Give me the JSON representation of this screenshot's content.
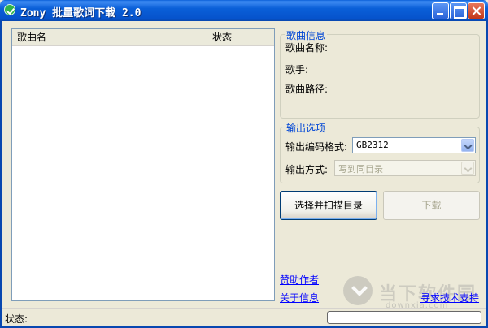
{
  "window": {
    "title": "Zony 批量歌词下载 2.0"
  },
  "list": {
    "columns": [
      "歌曲名",
      "状态"
    ]
  },
  "song_info": {
    "group_title": "歌曲信息",
    "name_label": "歌曲名称:",
    "artist_label": "歌手:",
    "path_label": "歌曲路径:"
  },
  "output": {
    "group_title": "输出选项",
    "encoding_label": "输出编码格式:",
    "encoding_value": "GB2312",
    "method_label": "输出方式:",
    "method_value": "写到同目录"
  },
  "buttons": {
    "scan": "选择并扫描目录",
    "download": "下载"
  },
  "links": {
    "sponsor": "赞助作者",
    "about": "关于信息",
    "support": "寻求技术支持"
  },
  "status": {
    "label": "状态:"
  },
  "watermark": {
    "text": "当下软件园",
    "sub": "downxia.com"
  },
  "colors": {
    "titlebar": "#0a5fd8",
    "window_bg": "#ece9d8",
    "group_title": "#0046d5",
    "link": "#0000ff"
  }
}
